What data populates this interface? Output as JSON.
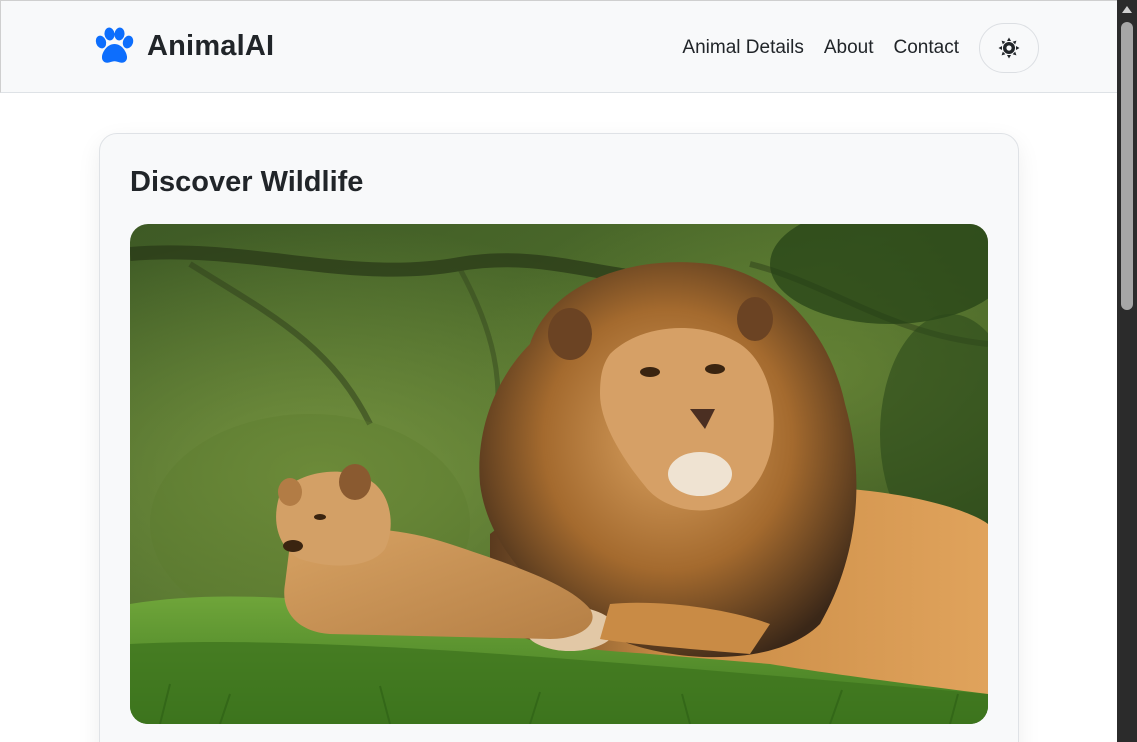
{
  "navbar": {
    "brand_name": "AnimalAI",
    "brand_color": "#0d6efd",
    "brand_icon": "paw-icon",
    "links": [
      {
        "label": "Animal Details"
      },
      {
        "label": "About"
      },
      {
        "label": "Contact"
      }
    ],
    "theme_toggle_icon": "sun-icon"
  },
  "main": {
    "card_title": "Discover Wildlife",
    "image_alt": "Lion and lion cub resting on grass"
  },
  "colors": {
    "accent": "#0d6efd",
    "text": "#212529",
    "navbar_bg": "#f8f9fa",
    "card_bg": "#f8f9fa"
  }
}
